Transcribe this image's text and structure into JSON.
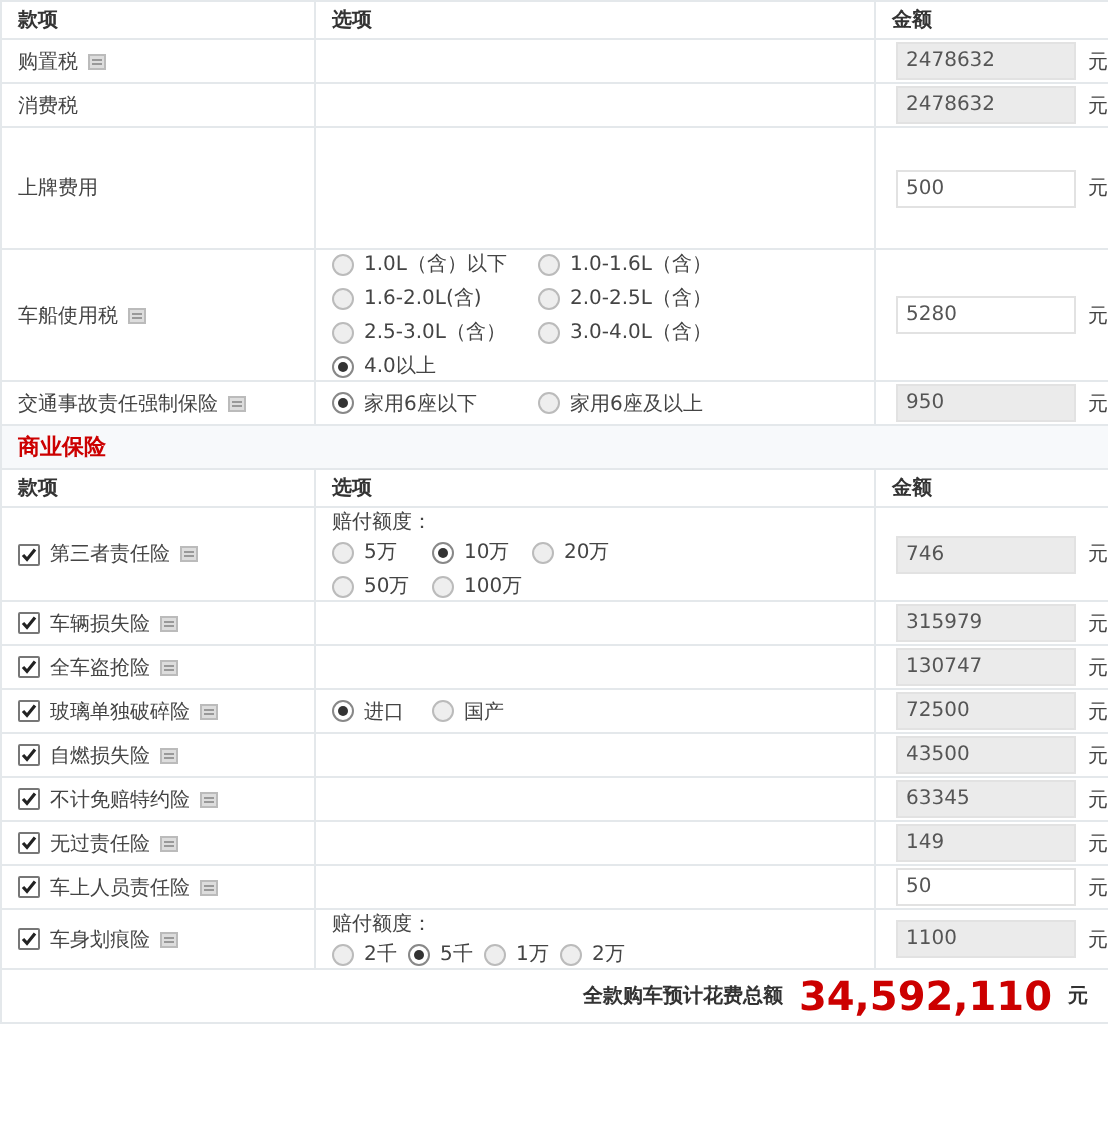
{
  "fees": {
    "columns": [
      "款项",
      "选项",
      "金额"
    ],
    "rows": [
      {
        "label": "购置税",
        "info": true,
        "amount": "2478632",
        "editable": false,
        "unit": "元"
      },
      {
        "label": "消费税",
        "info": false,
        "amount": "2478632",
        "editable": false,
        "unit": "元"
      },
      {
        "label": "上牌费用",
        "info": false,
        "amount": "500",
        "editable": true,
        "unit": "元"
      },
      {
        "label": "车船使用税",
        "info": true,
        "options": [
          {
            "label": "1.0L（含）以下",
            "selected": false
          },
          {
            "label": "1.0-1.6L（含）",
            "selected": false
          },
          {
            "label": "1.6-2.0L(含)",
            "selected": false
          },
          {
            "label": "2.0-2.5L（含）",
            "selected": false
          },
          {
            "label": "2.5-3.0L（含）",
            "selected": false
          },
          {
            "label": "3.0-4.0L（含）",
            "selected": false
          },
          {
            "label": "4.0以上",
            "selected": true
          }
        ],
        "amount": "5280",
        "editable": true,
        "unit": "元"
      },
      {
        "label": "交通事故责任强制保险",
        "info": true,
        "options": [
          {
            "label": "家用6座以下",
            "selected": true
          },
          {
            "label": "家用6座及以上",
            "selected": false
          }
        ],
        "amount": "950",
        "editable": false,
        "unit": "元"
      }
    ]
  },
  "commercial": {
    "title": "商业保险",
    "columns": [
      "款项",
      "选项",
      "金额"
    ],
    "rows": [
      {
        "label": "第三者责任险",
        "checked": true,
        "info": true,
        "option_title": "赔付额度：",
        "options": [
          {
            "label": "5万",
            "selected": false
          },
          {
            "label": "10万",
            "selected": true
          },
          {
            "label": "20万",
            "selected": false
          },
          {
            "label": "50万",
            "selected": false
          },
          {
            "label": "100万",
            "selected": false
          }
        ],
        "amount": "746",
        "editable": false,
        "unit": "元"
      },
      {
        "label": "车辆损失险",
        "checked": true,
        "info": true,
        "amount": "315979",
        "editable": false,
        "unit": "元"
      },
      {
        "label": "全车盗抢险",
        "checked": true,
        "info": true,
        "amount": "130747",
        "editable": false,
        "unit": "元"
      },
      {
        "label": "玻璃单独破碎险",
        "checked": true,
        "info": true,
        "options": [
          {
            "label": "进口",
            "selected": true
          },
          {
            "label": "国产",
            "selected": false
          }
        ],
        "amount": "72500",
        "editable": false,
        "unit": "元"
      },
      {
        "label": "自燃损失险",
        "checked": true,
        "info": true,
        "amount": "43500",
        "editable": false,
        "unit": "元"
      },
      {
        "label": "不计免赔特约险",
        "checked": true,
        "info": true,
        "amount": "63345",
        "editable": false,
        "unit": "元"
      },
      {
        "label": "无过责任险",
        "checked": true,
        "info": true,
        "amount": "149",
        "editable": false,
        "unit": "元"
      },
      {
        "label": "车上人员责任险",
        "checked": true,
        "info": true,
        "amount": "50",
        "editable": true,
        "unit": "元"
      },
      {
        "label": "车身划痕险",
        "checked": true,
        "info": true,
        "option_title": "赔付额度：",
        "options": [
          {
            "label": "2千",
            "selected": false
          },
          {
            "label": "5千",
            "selected": true
          },
          {
            "label": "1万",
            "selected": false
          },
          {
            "label": "2万",
            "selected": false
          }
        ],
        "amount": "1100",
        "editable": false,
        "unit": "元"
      }
    ]
  },
  "total": {
    "label": "全款购车预计花费总额",
    "value": "34,592,110",
    "unit": "元"
  }
}
